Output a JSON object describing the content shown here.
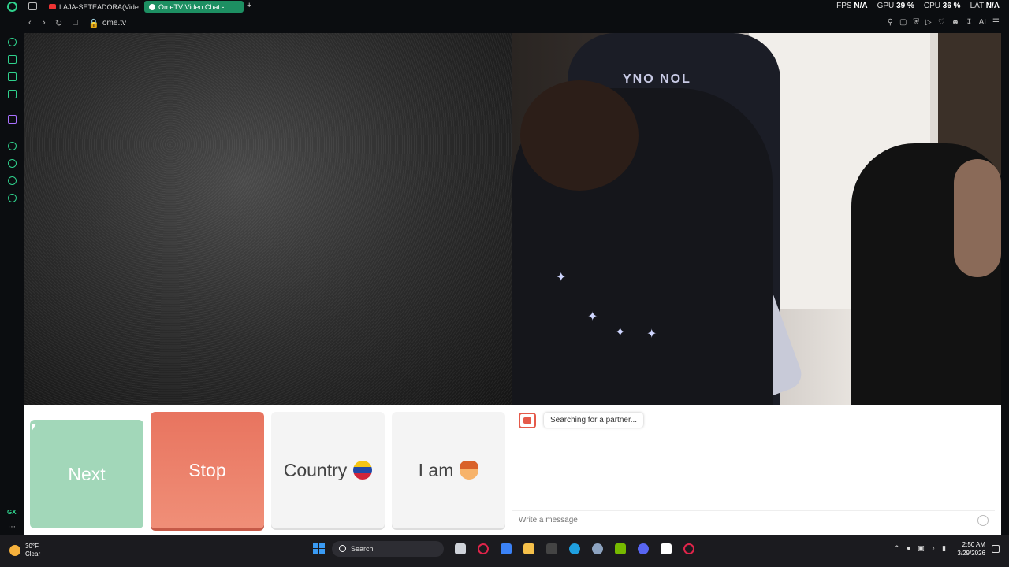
{
  "browser": {
    "tabs": [
      {
        "label": "LAJA-SETEADORA(Video"
      },
      {
        "label": "OmeTV Video Chat -"
      }
    ],
    "url": "ome.tv",
    "stats": {
      "fps_label": "FPS",
      "fps_value": "N/A",
      "gpu_label": "GPU",
      "gpu_value": "39 %",
      "cpu_label": "CPU",
      "cpu_value": "36 %",
      "lat_label": "LAT",
      "lat_value": "N/A"
    },
    "ai_label": "AI",
    "gx_label": "GX"
  },
  "video": {
    "chair_logo": "YNO NOL"
  },
  "controls": {
    "next_label": "Next",
    "stop_label": "Stop",
    "country_label": "Country",
    "iam_label": "I am"
  },
  "chat": {
    "status": "Searching for a partner...",
    "input_placeholder": "Write a message"
  },
  "taskbar": {
    "temperature": "30°F",
    "condition": "Clear",
    "search_label": "Search",
    "time": "2:50 AM",
    "date": "3/29/2026"
  },
  "colors": {
    "next": "#a2d7b9",
    "stop": "#ec7d67",
    "accent": "#2fd18c"
  }
}
